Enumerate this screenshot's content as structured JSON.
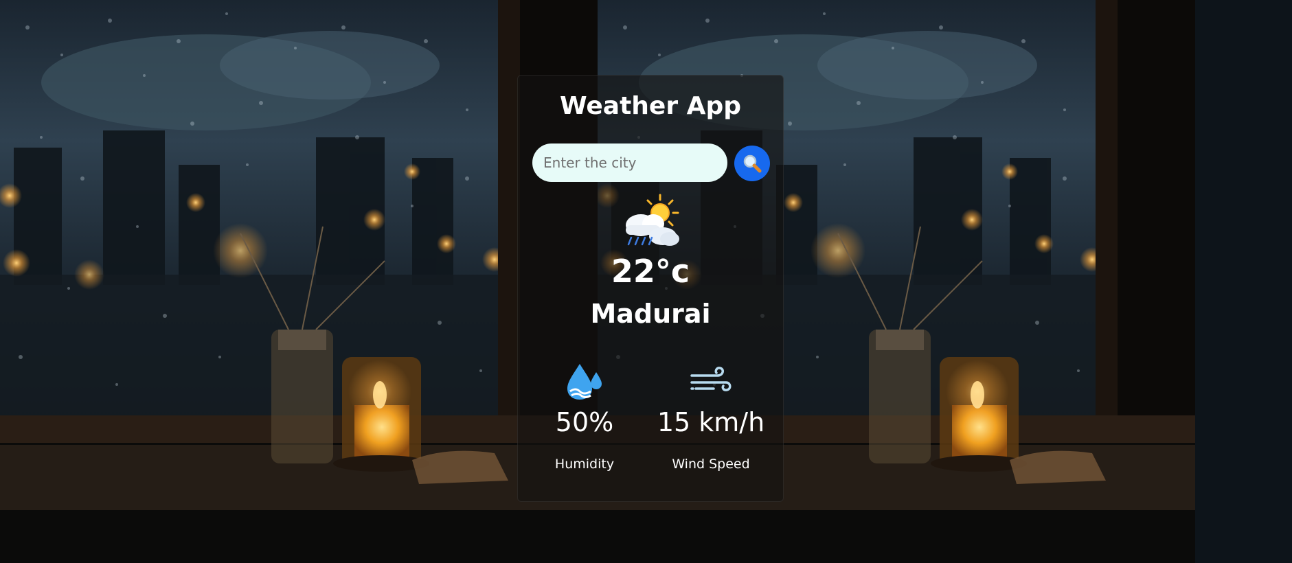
{
  "app": {
    "title": "Weather App"
  },
  "search": {
    "placeholder": "Enter the city",
    "value": "",
    "button_icon": "magnifier-icon"
  },
  "current": {
    "condition_icon": "partly-cloudy-rain-icon",
    "temperature": "22°c",
    "city": "Madurai"
  },
  "details": {
    "humidity": {
      "icon": "humidity-drops-icon",
      "value": "50%",
      "label": "Humidity"
    },
    "wind": {
      "icon": "wind-icon",
      "value": "15 km/h",
      "label": "Wind Speed"
    }
  },
  "colors": {
    "search_button": "#1769ee",
    "search_input_bg": "#e7fbf8",
    "text": "#ffffff"
  }
}
